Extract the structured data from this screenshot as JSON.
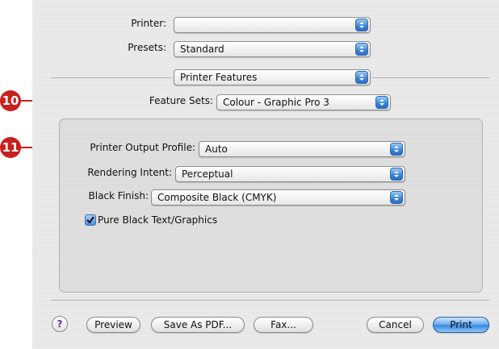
{
  "printer": {
    "label": "Printer:",
    "value": ""
  },
  "presets": {
    "label": "Presets:",
    "value": "Standard"
  },
  "section": {
    "value": "Printer Features"
  },
  "feature_sets": {
    "label": "Feature Sets:",
    "value": "Colour - Graphic Pro 3"
  },
  "panel": {
    "output_profile": {
      "label": "Printer Output Profile:",
      "value": "Auto"
    },
    "rendering_intent": {
      "label": "Rendering Intent:",
      "value": "Perceptual"
    },
    "black_finish": {
      "label": "Black Finish:",
      "value": "Composite Black (CMYK)"
    },
    "pure_black": {
      "label": "Pure Black Text/Graphics",
      "checked": true
    }
  },
  "buttons": {
    "help": "?",
    "preview": "Preview",
    "save_pdf": "Save As PDF...",
    "fax": "Fax...",
    "cancel": "Cancel",
    "print": "Print"
  },
  "callouts": {
    "ten": "10",
    "eleven": "11"
  },
  "colors": {
    "accent": "#3a88e0",
    "callout": "#c8201e"
  }
}
